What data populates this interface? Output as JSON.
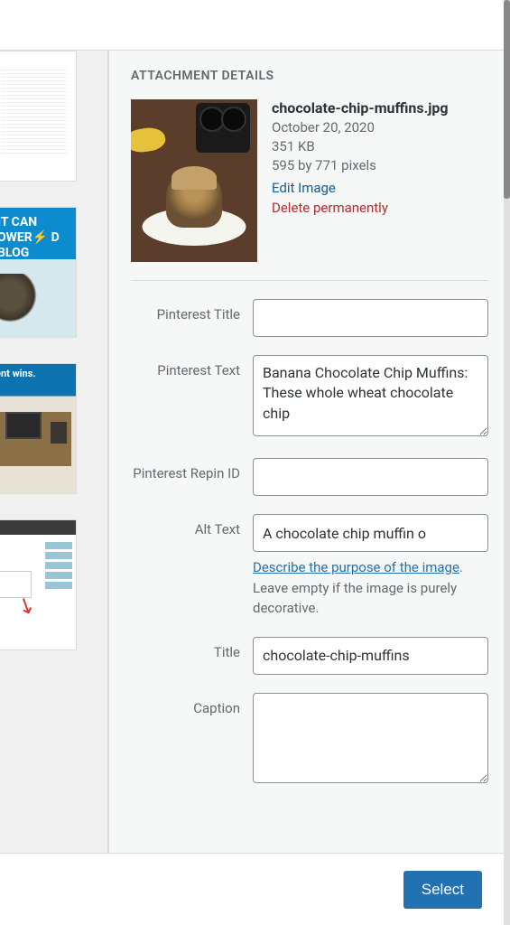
{
  "panel_title": "ATTACHMENT DETAILS",
  "attachment": {
    "filename": "chocolate-chip-muffins.jpg",
    "date": "October 20, 2020",
    "filesize": "351 KB",
    "dimensions": "595 by 771 pixels",
    "edit_label": "Edit Image",
    "delete_label": "Delete permanently"
  },
  "fields": {
    "pinterest_title": {
      "label": "Pinterest Title",
      "value": ""
    },
    "pinterest_text": {
      "label": "Pinterest Text",
      "value": "Banana Chocolate Chip Muffins: These whole wheat chocolate chip"
    },
    "pinterest_repin": {
      "label": "Pinterest Repin ID",
      "value": ""
    },
    "alt_text": {
      "label": "Alt Text",
      "value": "A chocolate chip muffin o",
      "help_link": "Describe the purpose of the image",
      "help_rest": ". Leave empty if the image is purely decorative."
    },
    "title": {
      "label": "Title",
      "value": "chocolate-chip-muffins"
    },
    "caption": {
      "label": "Caption",
      "value": ""
    }
  },
  "library_thumbs": {
    "thumb2_text": "IT CAN\nOWER⚡\nD BLOG",
    "thumb3_text": "ent wins."
  },
  "footer": {
    "select_label": "Select"
  }
}
